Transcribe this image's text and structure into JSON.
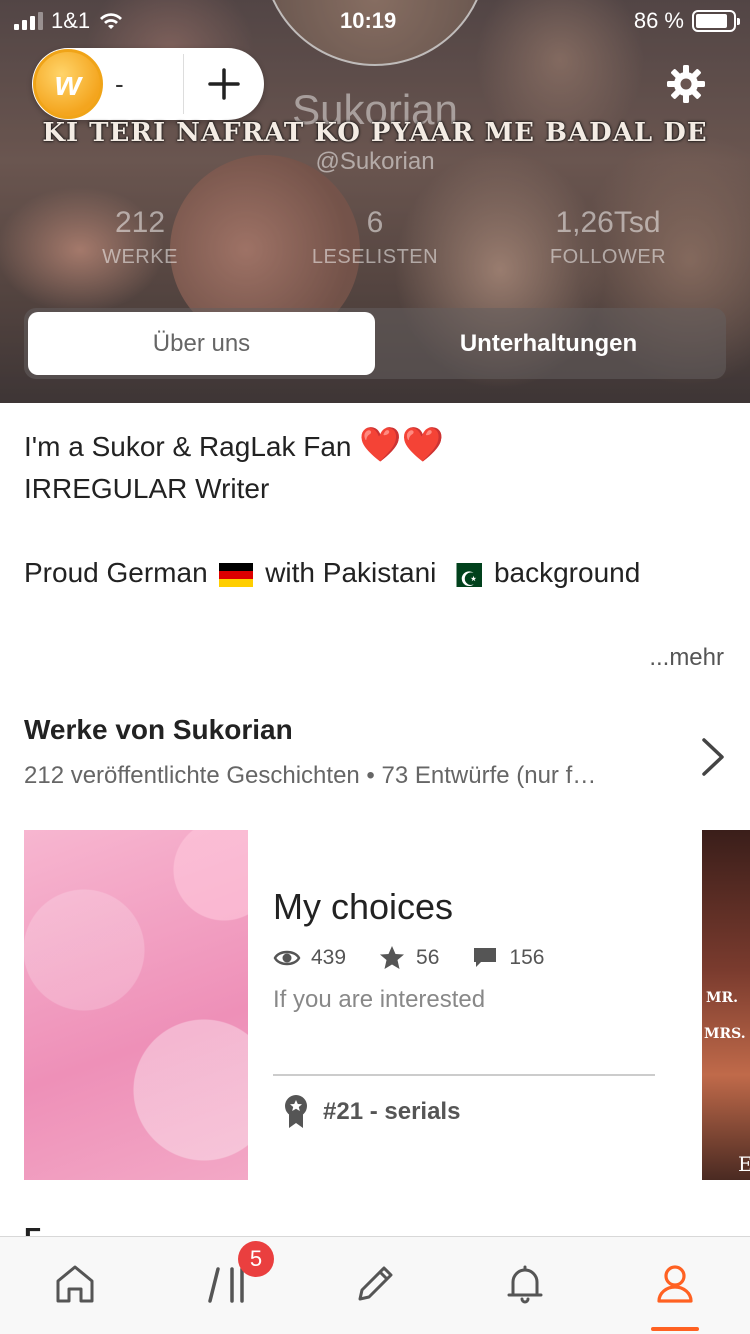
{
  "status_bar": {
    "carrier": "1&1",
    "time": "10:19",
    "battery": "86 %"
  },
  "coins": {
    "logo_letter": "w",
    "count": "-"
  },
  "profile": {
    "name": "Sukorian",
    "banner_text": "KI TERI NAFRAT KO PYAAR ME BADAL DE",
    "handle": "@Sukorian",
    "stats": [
      {
        "value": "212",
        "label": "WERKE"
      },
      {
        "value": "6",
        "label": "LESELISTEN"
      },
      {
        "value": "1,26Tsd",
        "label": "FOLLOWER"
      }
    ]
  },
  "tabs": [
    {
      "label": "Über uns",
      "active": true
    },
    {
      "label": "Unterhaltungen",
      "active": false
    }
  ],
  "about": {
    "line1": "I'm a Sukor & RagLak Fan",
    "line1_emoji": "❤️❤️",
    "line2": "IRREGULAR Writer",
    "line3_a": "Proud German",
    "line3_b": "with Pakistani",
    "line3_c": "background",
    "more": "...mehr"
  },
  "works": {
    "title": "Werke von Sukorian",
    "subtitle": "212 veröffentlichte Geschichten • 73 Entwürfe (nur f…",
    "story": {
      "title": "My choices",
      "reads": "439",
      "votes": "56",
      "comments": "156",
      "description": "If you are interested",
      "rank": "#21 - serials"
    },
    "peek_cover": {
      "line1": "MR.",
      "line2": "MRS.",
      "line3": "E"
    }
  },
  "next_section_title": "F",
  "tabbar": {
    "items": [
      {
        "icon": "home-icon"
      },
      {
        "icon": "library-icon",
        "badge": "5"
      },
      {
        "icon": "pencil-icon"
      },
      {
        "icon": "bell-icon"
      },
      {
        "icon": "profile-icon",
        "active": true
      }
    ]
  },
  "colors": {
    "accent": "#ff6122",
    "badge": "#ea3f3f",
    "coin": "#f4a51e"
  }
}
